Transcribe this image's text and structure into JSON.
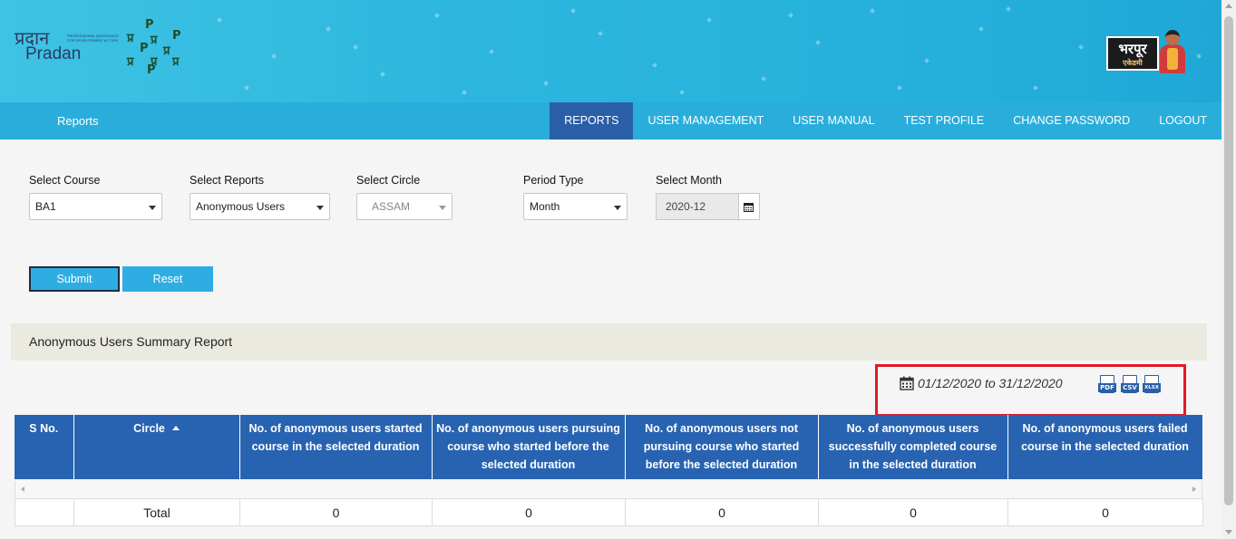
{
  "header": {
    "logo_pradan_hindi": "प्रदान",
    "logo_pradan_english": "Pradan",
    "logo_pradan_tagline": "PROFESSIONAL ASSISTANCE FOR DEVELOPMENT ACTION",
    "brand_right_hindi": "भरपूर",
    "brand_right_sub": "एकेडमी"
  },
  "nav": {
    "brand": "Reports",
    "items": [
      {
        "label": "REPORTS",
        "active": true
      },
      {
        "label": "USER MANAGEMENT",
        "active": false
      },
      {
        "label": "USER MANUAL",
        "active": false
      },
      {
        "label": "TEST PROFILE",
        "active": false
      },
      {
        "label": "CHANGE PASSWORD",
        "active": false
      },
      {
        "label": "LOGOUT",
        "active": false
      }
    ],
    "accent_color": "#29aedb",
    "active_color": "#2a5fa8"
  },
  "filters": {
    "course": {
      "label": "Select Course",
      "value": "BA1"
    },
    "reports": {
      "label": "Select Reports",
      "value": "Anonymous Users"
    },
    "circle": {
      "label": "Select Circle",
      "value": "ASSAM"
    },
    "period": {
      "label": "Period Type",
      "value": "Month"
    },
    "month": {
      "label": "Select Month",
      "value": "2020-12"
    }
  },
  "buttons": {
    "submit": "Submit",
    "reset": "Reset"
  },
  "report": {
    "title": "Anonymous Users Summary Report",
    "date_range": "01/12/2020 to 31/12/2020",
    "exports": [
      "PDF",
      "CSV",
      "XLSX"
    ],
    "columns": [
      "S No.",
      "Circle",
      "No. of anonymous users started course in the selected duration",
      "No. of anonymous users pursuing course who started before the selected duration",
      "No. of anonymous users not pursuing course who started before the selected duration",
      "No. of anonymous users successfully completed course in the selected duration",
      "No. of anonymous users failed course in the selected duration"
    ],
    "total": {
      "label": "Total",
      "values": [
        "0",
        "0",
        "0",
        "0",
        "0"
      ]
    }
  }
}
